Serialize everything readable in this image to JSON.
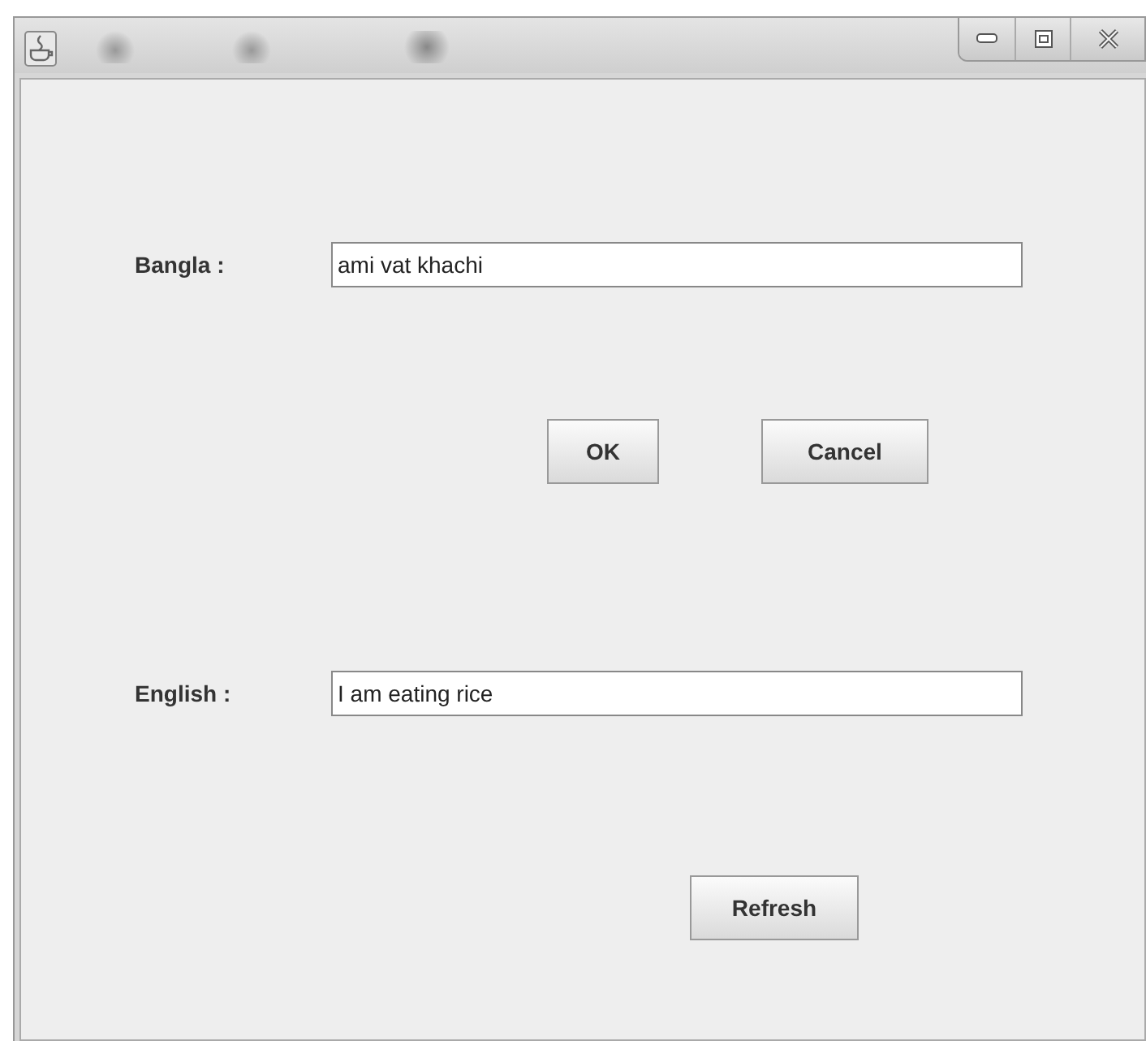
{
  "rows": [
    {
      "kind": "field",
      "label": "Bangla :",
      "value": "ami vat khachi"
    },
    {
      "kind": "buttons",
      "buttons": [
        "OK",
        "Cancel"
      ]
    },
    {
      "kind": "field",
      "label": "English :",
      "value": "I am eating rice"
    },
    {
      "kind": "buttons",
      "buttons": [
        "Refresh"
      ]
    }
  ]
}
